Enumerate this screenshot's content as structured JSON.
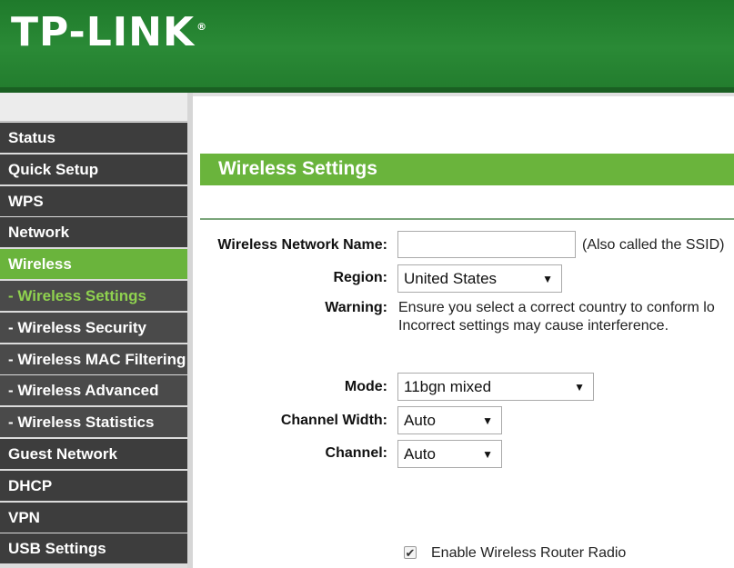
{
  "header": {
    "logo": "TP-LINK",
    "logo_mark": "®"
  },
  "sidebar": {
    "items": [
      {
        "label": "Status"
      },
      {
        "label": "Quick Setup"
      },
      {
        "label": "WPS"
      },
      {
        "label": "Network"
      },
      {
        "label": "Wireless"
      },
      {
        "label": "- Wireless Settings"
      },
      {
        "label": "- Wireless Security"
      },
      {
        "label": "- Wireless MAC Filtering"
      },
      {
        "label": "- Wireless Advanced"
      },
      {
        "label": "- Wireless Statistics"
      },
      {
        "label": "Guest Network"
      },
      {
        "label": "DHCP"
      },
      {
        "label": "VPN"
      },
      {
        "label": "USB Settings"
      }
    ]
  },
  "main": {
    "title": "Wireless Settings",
    "ssid": {
      "label": "Wireless Network Name:",
      "value": "",
      "note": "(Also called the SSID)"
    },
    "region": {
      "label": "Region:",
      "value": "United States"
    },
    "warning": {
      "label": "Warning:",
      "line1": "Ensure you select a correct country to conform lo",
      "line2": "Incorrect settings may cause interference."
    },
    "mode": {
      "label": "Mode:",
      "value": "11bgn mixed"
    },
    "channel_width": {
      "label": "Channel Width:",
      "value": "Auto"
    },
    "channel": {
      "label": "Channel:",
      "value": "Auto"
    },
    "radio": {
      "label": "Enable Wireless Router Radio",
      "checked": true
    },
    "dropdown_icon": "▼",
    "check_icon": "✔"
  }
}
